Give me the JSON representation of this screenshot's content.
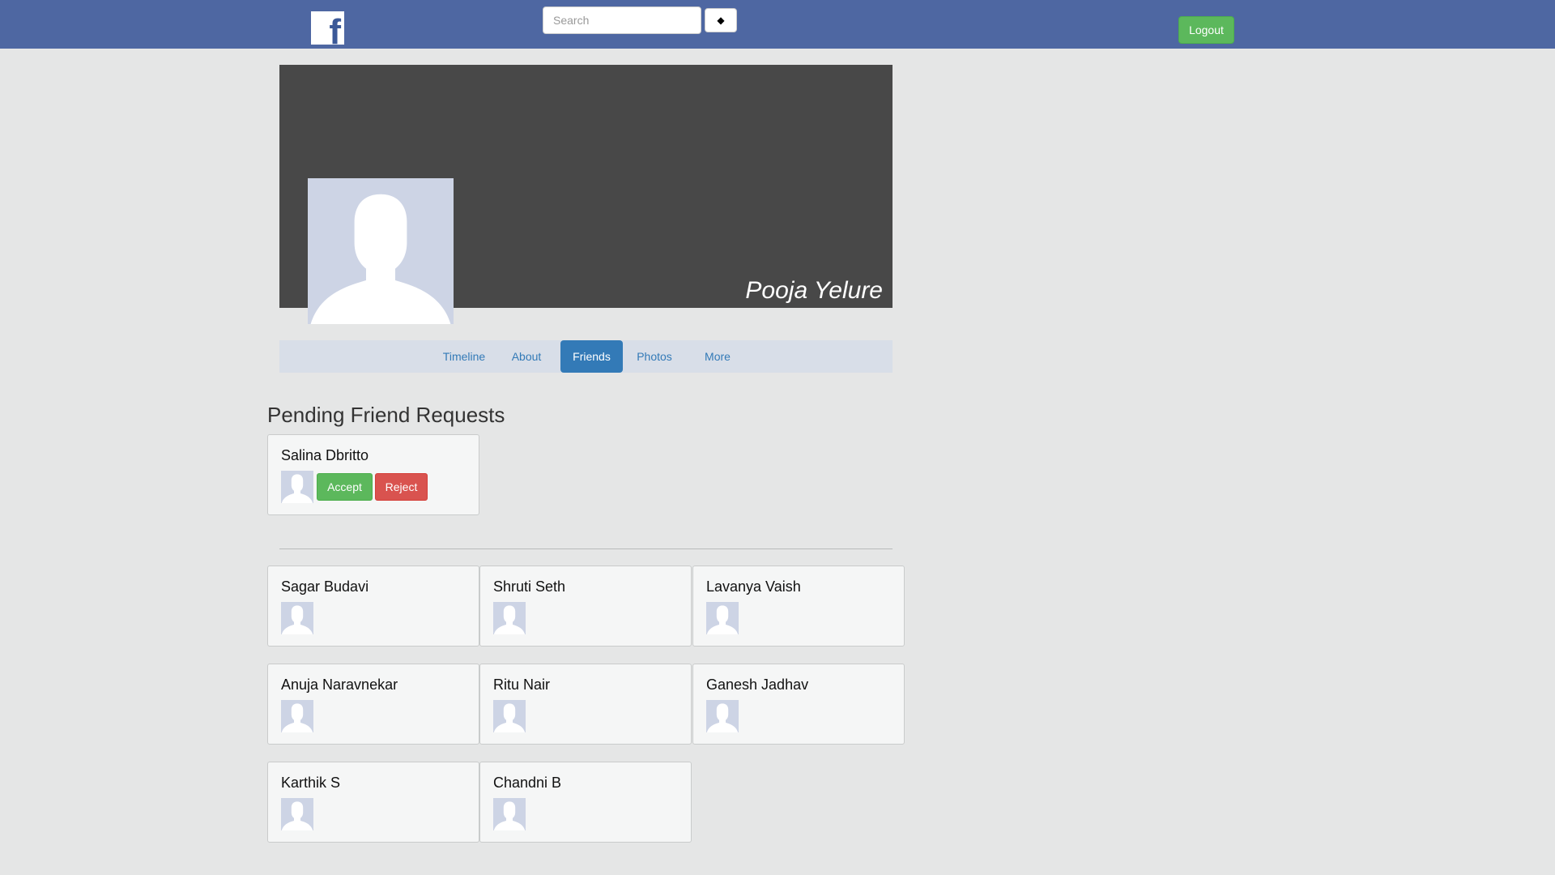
{
  "header": {
    "logo_letter": "f",
    "search": {
      "placeholder": "Search",
      "value": ""
    },
    "search_button_icon": "search-icon",
    "search_button_glyph": "◆",
    "logout_label": "Logout"
  },
  "profile": {
    "name": "Pooja Yelure",
    "picture_icon": "default-avatar-silhouette"
  },
  "nav": {
    "tabs": [
      {
        "label": "Timeline",
        "active": false
      },
      {
        "label": "About",
        "active": false
      },
      {
        "label": "Friends",
        "active": true
      },
      {
        "label": "Photos",
        "active": false
      },
      {
        "label": "More",
        "active": false
      }
    ]
  },
  "pending": {
    "title": "Pending Friend Requests",
    "requests": [
      {
        "name": "Salina Dbritto",
        "accept_label": "Accept",
        "reject_label": "Reject"
      }
    ]
  },
  "friends": [
    {
      "name": "Sagar Budavi"
    },
    {
      "name": "Shruti Seth"
    },
    {
      "name": "Lavanya Vaish"
    },
    {
      "name": "Anuja Naravnekar"
    },
    {
      "name": "Ritu Nair"
    },
    {
      "name": "Ganesh Jadhav"
    },
    {
      "name": "Karthik S"
    },
    {
      "name": "Chandni B"
    }
  ],
  "colors": {
    "topbar": "#4e67a2",
    "accept": "#5cb85c",
    "reject": "#d9534f",
    "nav_active": "#337ab7",
    "cover": "#484848",
    "avatar_bg": "#cdd4e5"
  }
}
